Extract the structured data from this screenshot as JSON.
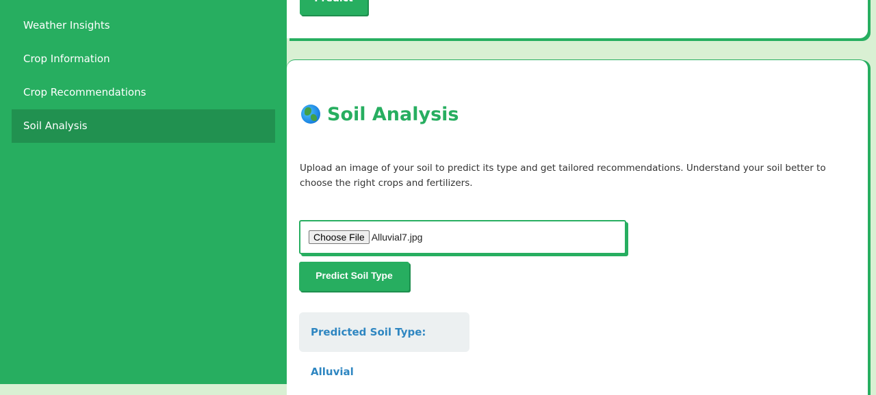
{
  "sidebar": {
    "items": [
      {
        "label": "Weather Insights",
        "active": false
      },
      {
        "label": "Crop Information",
        "active": false
      },
      {
        "label": "Crop Recommendations",
        "active": false
      },
      {
        "label": "Soil Analysis",
        "active": true
      }
    ]
  },
  "top_card": {
    "predict_label": "Predict"
  },
  "soil": {
    "icon": "globe-icon",
    "title": "Soil Analysis",
    "description": "Upload an image of your soil to predict its type and get tailored recommendations. Understand your soil better to choose the right crops and fertilizers.",
    "choose_file_label": "Choose File",
    "file_name": "Alluvial7.jpg",
    "predict_label": "Predict Soil Type",
    "result": "Predicted Soil Type: Alluvial"
  },
  "colors": {
    "accent": "#27ae60",
    "accent_dark": "#219150",
    "background": "#d9f0d3",
    "result_text": "#2e86c1"
  }
}
